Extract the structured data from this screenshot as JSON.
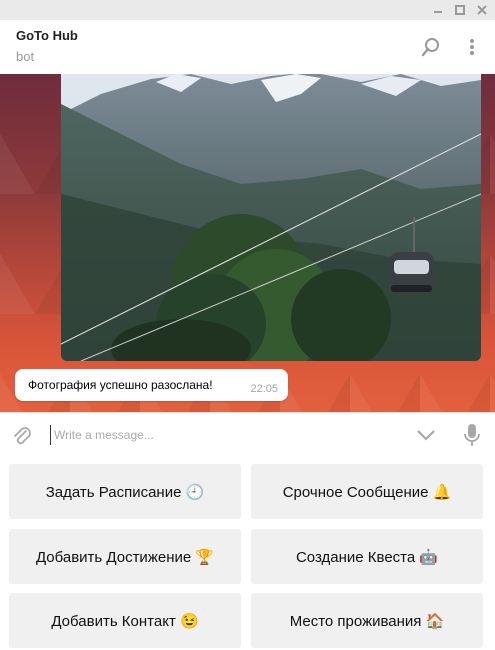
{
  "window": {
    "controls": {
      "minimize": "▬",
      "maximize": "▢",
      "close": "✕"
    }
  },
  "header": {
    "title": "GoTo Hub",
    "status": "bot",
    "icons": [
      "search-icon",
      "more-vertical-icon"
    ]
  },
  "chat": {
    "photo": {
      "description_icon": "photo-message"
    },
    "messages": [
      {
        "text": "Фотография успешно разослана!",
        "time": "22:05"
      }
    ]
  },
  "composer": {
    "placeholder": "Write a message...",
    "value": "",
    "icons": [
      "attach-icon",
      "keyboard-toggle-icon",
      "microphone-icon"
    ]
  },
  "keyboard": {
    "buttons": [
      {
        "label": "Задать Расписание 🕘"
      },
      {
        "label": "Срочное Сообщение 🔔"
      },
      {
        "label": "Добавить Достижение 🏆"
      },
      {
        "label": "Создание Квеста 🤖"
      },
      {
        "label": "Добавить Контакт 😉"
      },
      {
        "label": "Место проживания 🏠"
      }
    ]
  },
  "colors": {
    "header_bg": "#ffffff",
    "bubble_bg": "#ffffff",
    "keyboard_button_bg": "#f0f0f0",
    "icon_gray": "#9a9a9a"
  }
}
